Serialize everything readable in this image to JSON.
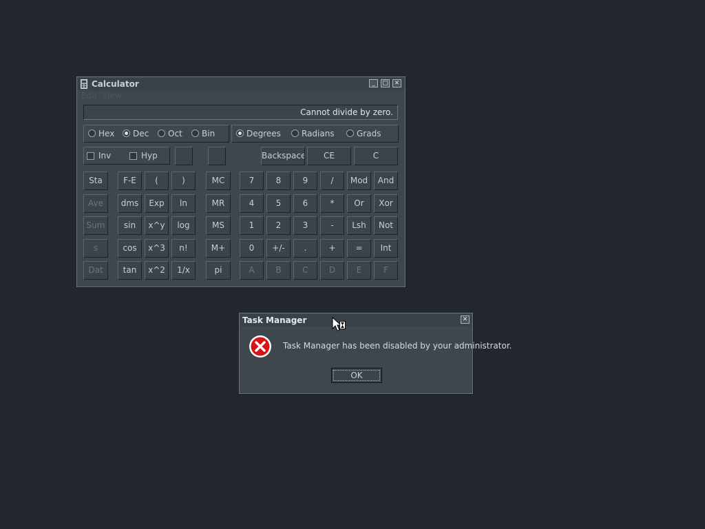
{
  "calculator": {
    "title": "Calculator",
    "menu": [
      "Edit",
      "View"
    ],
    "display": "Cannot divide by zero.",
    "bases": [
      {
        "label": "Hex",
        "selected": false
      },
      {
        "label": "Dec",
        "selected": true
      },
      {
        "label": "Oct",
        "selected": false
      },
      {
        "label": "Bin",
        "selected": false
      }
    ],
    "angles": [
      {
        "label": "Degrees",
        "selected": true
      },
      {
        "label": "Radians",
        "selected": false
      },
      {
        "label": "Grads",
        "selected": false
      }
    ],
    "inv_label": "Inv",
    "hyp_label": "Hyp",
    "backspace_label": "Backspace",
    "ce_label": "CE",
    "c_label": "C",
    "stat_keys": [
      "Sta",
      "Ave",
      "Sum",
      "s",
      "Dat"
    ],
    "function_keys": [
      [
        "F-E",
        "(",
        ")"
      ],
      [
        "dms",
        "Exp",
        "ln"
      ],
      [
        "sin",
        "x^y",
        "log"
      ],
      [
        "cos",
        "x^3",
        "n!"
      ],
      [
        "tan",
        "x^2",
        "1/x"
      ]
    ],
    "memory_keys": [
      "MC",
      "MR",
      "MS",
      "M+",
      "pi"
    ],
    "main_keys": [
      [
        "7",
        "8",
        "9",
        "/",
        "Mod",
        "And"
      ],
      [
        "4",
        "5",
        "6",
        "*",
        "Or",
        "Xor"
      ],
      [
        "1",
        "2",
        "3",
        "-",
        "Lsh",
        "Not"
      ],
      [
        "0",
        "+/-",
        ".",
        "+",
        "=",
        "Int"
      ],
      [
        "A",
        "B",
        "C",
        "D",
        "E",
        "F"
      ]
    ]
  },
  "dialog": {
    "title": "Task Manager",
    "message": "Task Manager has been disabled by your administrator.",
    "ok_label": "OK"
  },
  "icons": {
    "calculator": "calculator-icon",
    "error": "error-icon",
    "cursor": "busy-cursor-icon"
  },
  "colors": {
    "desktop": "#22272e",
    "window": "#3e464e",
    "error_red": "#d3161c"
  }
}
